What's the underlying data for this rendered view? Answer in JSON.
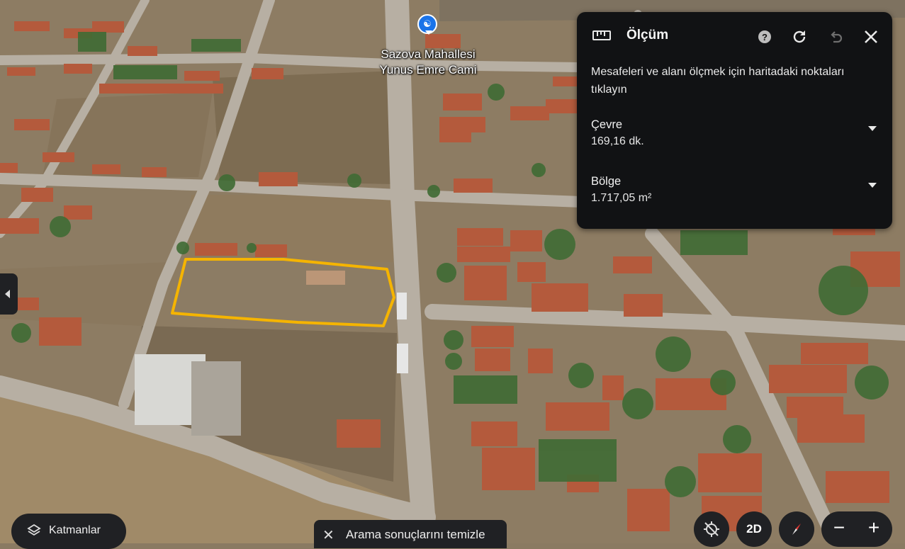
{
  "map": {
    "poi_name_line1": "Sazova Mahallesi",
    "poi_name_line2": "Yunus Emre Cami",
    "polygon_color": "#f5b400"
  },
  "measure_panel": {
    "title": "Ölçüm",
    "description": "Mesafeleri ve alanı ölçmek için haritadaki noktaları tıklayın",
    "perimeter_label": "Çevre",
    "perimeter_value": "169,16 dk.",
    "area_label": "Bölge",
    "area_value": "1.717,05 m²",
    "help_glyph": "?"
  },
  "controls": {
    "layers_label": "Katmanlar",
    "clear_results_label": "Arama sonuçlarını temizle",
    "view_mode_label": "2D",
    "zoom_out": "−",
    "zoom_in": "+"
  },
  "icons": [
    "ruler-icon",
    "help-icon",
    "refresh-icon",
    "undo-icon",
    "close-icon",
    "layers-icon",
    "location-off-icon",
    "compass-icon",
    "mosque-pin-icon"
  ]
}
